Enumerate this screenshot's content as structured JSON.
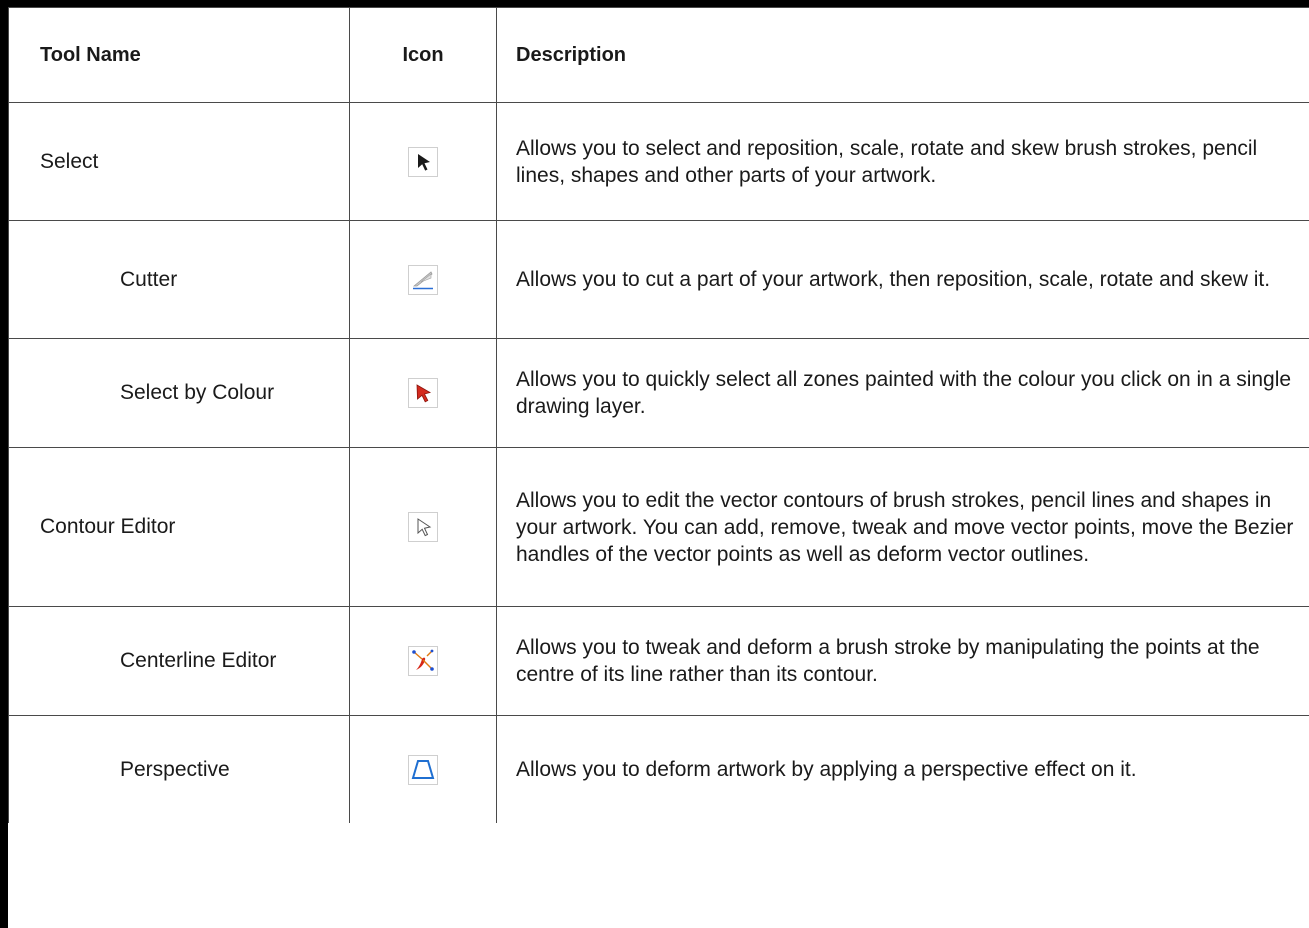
{
  "table": {
    "headers": {
      "tool_name": "Tool Name",
      "icon": "Icon",
      "description": "Description"
    },
    "rows": [
      {
        "name": "Select",
        "icon": "select-arrow-icon",
        "description": "Allows you to select and reposition, scale, rotate and skew brush strokes, pencil lines, shapes and other parts of your artwork."
      },
      {
        "name": "Cutter",
        "icon": "cutter-icon",
        "description": "Allows you to cut a part of your artwork, then reposition, scale, rotate and skew it."
      },
      {
        "name": "Select by Colour",
        "icon": "select-by-colour-icon",
        "description": "Allows you to quickly select all zones painted with the colour you click on in a single drawing layer."
      },
      {
        "name": "Contour Editor",
        "icon": "contour-editor-icon",
        "description": "Allows you to edit the vector contours of brush strokes, pencil lines and shapes in your artwork. You can add, remove, tweak and move vector points, move the Bezier handles of the vector points as well as deform vector outlines."
      },
      {
        "name": "Centerline Editor",
        "icon": "centerline-editor-icon",
        "description": "Allows you to tweak and deform a brush stroke by manipulating the points at the centre of its line rather than its contour."
      },
      {
        "name": "Perspective",
        "icon": "perspective-icon",
        "description": "Allows you to deform artwork by applying a perspective effect on it."
      }
    ]
  },
  "colors": {
    "border": "#4a4a4a",
    "select_by_colour_red": "#d42a1e",
    "perspective_blue": "#1f6fd1"
  }
}
